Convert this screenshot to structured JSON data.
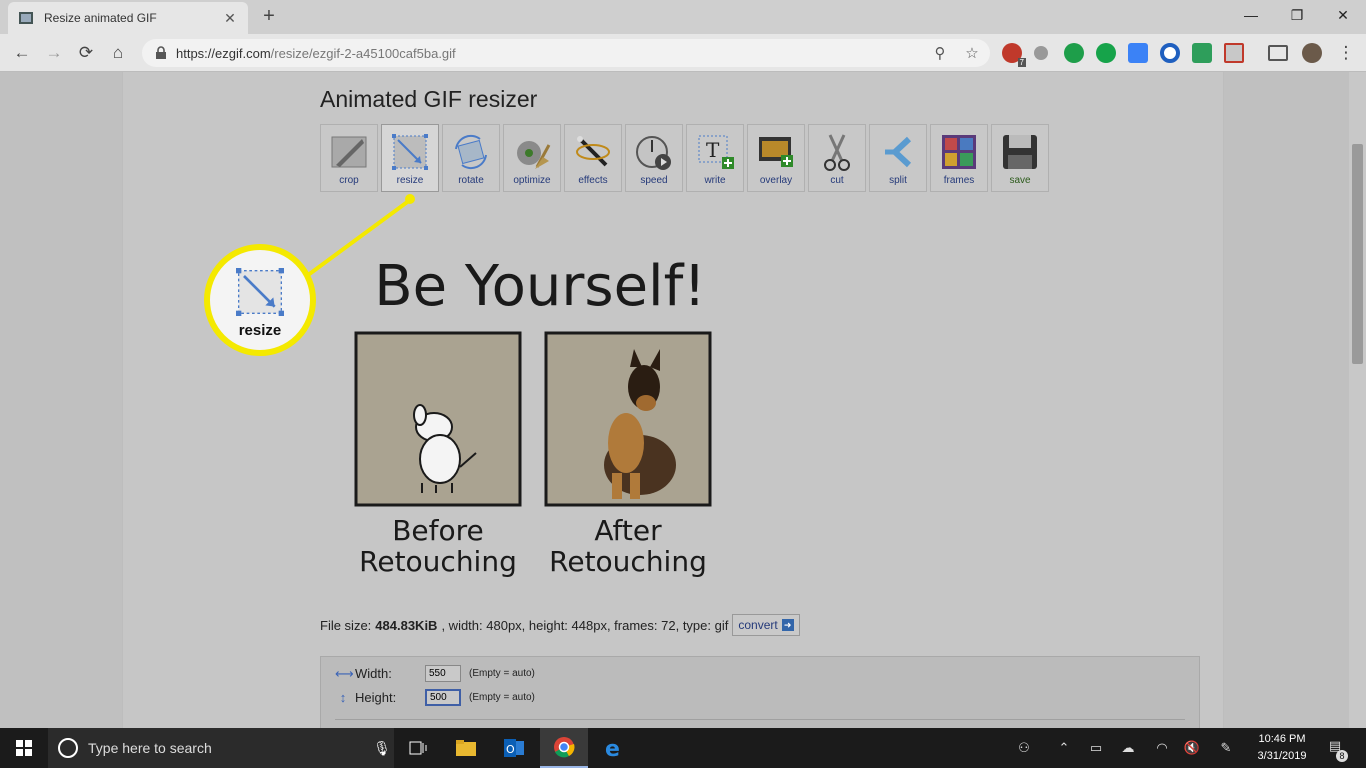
{
  "browser": {
    "tab_title": "Resize animated GIF",
    "tab_close": "✕",
    "new_tab": "+",
    "url_host": "https://ezgif.com",
    "url_path": "/resize/ezgif-2-a45100caf5ba.gif",
    "window_controls": {
      "minimize": "—",
      "restore": "❐",
      "close": "✕"
    },
    "adblock_badge": "7"
  },
  "page": {
    "title": "Animated GIF resizer",
    "tools": [
      {
        "label": "crop",
        "icon": "crop-icon"
      },
      {
        "label": "resize",
        "icon": "resize-icon",
        "active": true
      },
      {
        "label": "rotate",
        "icon": "rotate-icon"
      },
      {
        "label": "optimize",
        "icon": "optimize-icon"
      },
      {
        "label": "effects",
        "icon": "effects-icon"
      },
      {
        "label": "speed",
        "icon": "speed-icon"
      },
      {
        "label": "write",
        "icon": "write-icon"
      },
      {
        "label": "overlay",
        "icon": "overlay-icon"
      },
      {
        "label": "cut",
        "icon": "cut-icon"
      },
      {
        "label": "split",
        "icon": "split-icon"
      },
      {
        "label": "frames",
        "icon": "frames-icon"
      },
      {
        "label": "save",
        "icon": "save-icon"
      }
    ],
    "gif": {
      "headline": "Be Yourself!",
      "left_caption_1": "Before",
      "left_caption_2": "Retouching",
      "right_caption_1": "After",
      "right_caption_2": "Retouching"
    },
    "file_info": {
      "prefix": "File size:",
      "size": "484.83KiB",
      "rest": ", width: 480px, height: 448px, frames: 72, type: gif",
      "convert_label": "convert"
    },
    "form": {
      "width_label": "Width:",
      "width_value": "550",
      "height_label": "Height:",
      "height_value": "500",
      "hint": "(Empty = auto)"
    },
    "callout_label": "resize"
  },
  "taskbar": {
    "search_placeholder": "Type here to search",
    "time": "10:46 PM",
    "date": "3/31/2019",
    "notification_count": "8"
  },
  "colors": {
    "callout_ring": "#f4e900",
    "link_blue": "#253a7a"
  }
}
